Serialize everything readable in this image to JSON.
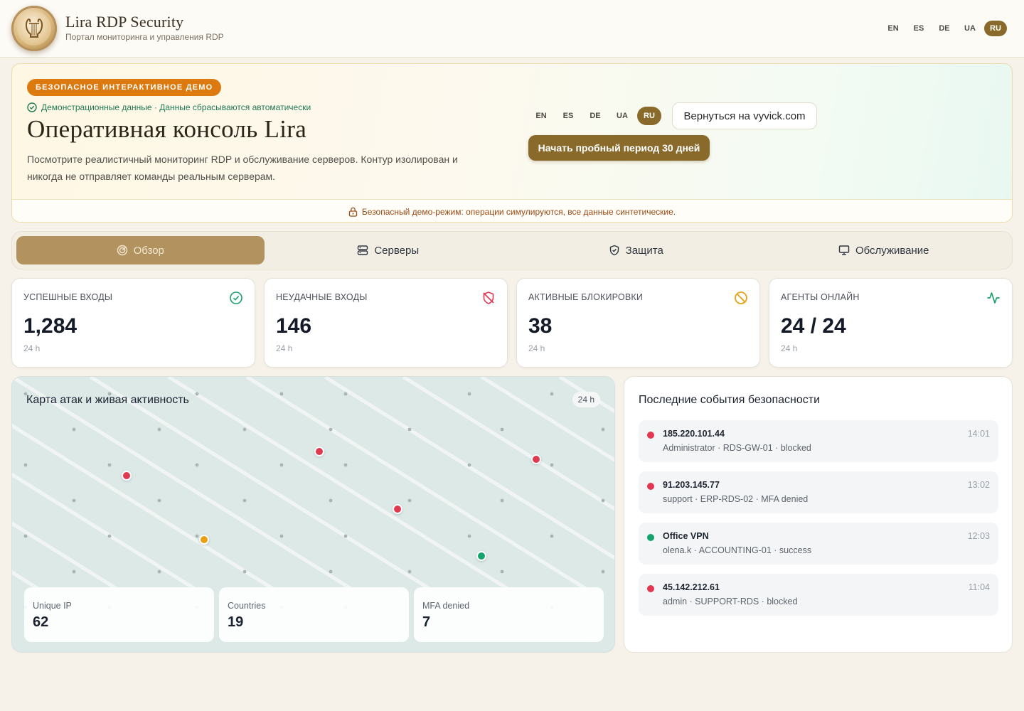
{
  "header": {
    "title": "Lira RDP Security",
    "subtitle": "Портал мониторинга и управления RDP",
    "languages": [
      "EN",
      "ES",
      "DE",
      "UA",
      "RU"
    ],
    "active_language": "RU"
  },
  "hero": {
    "badge": "БЕЗОПАСНОЕ ИНТЕРАКТИВНОЕ ДЕМО",
    "note": "Демонстрационные данные · Данные сбрасываются автоматически",
    "title": "Оперативная консоль Lira",
    "description": "Посмотрите реалистичный мониторинг RDP и обслуживание серверов. Контур изолирован и никогда не отправляет команды реальным серверам.",
    "languages": [
      "EN",
      "ES",
      "DE",
      "UA",
      "RU"
    ],
    "active_language": "RU",
    "back_label": "Вернуться на vyvick.com",
    "trial_label": "Начать пробный период 30 дней",
    "safe_mode_note": "Безопасный демо-режим: операции симулируются, все данные синтетические."
  },
  "tabs": [
    {
      "label": "Обзор",
      "icon": "radar-icon",
      "active": true
    },
    {
      "label": "Серверы",
      "icon": "server-icon",
      "active": false
    },
    {
      "label": "Защита",
      "icon": "shield-icon",
      "active": false
    },
    {
      "label": "Обслуживание",
      "icon": "monitor-icon",
      "active": false
    }
  ],
  "stats": [
    {
      "label": "УСПЕШНЫЕ ВХОДЫ",
      "value": "1,284",
      "period": "24 h",
      "icon": "check-circle-icon",
      "color": "#1aa06a"
    },
    {
      "label": "НЕУДАЧНЫЕ ВХОДЫ",
      "value": "146",
      "period": "24 h",
      "icon": "shield-off-icon",
      "color": "#e0384f"
    },
    {
      "label": "АКТИВНЫЕ БЛОКИРОВКИ",
      "value": "38",
      "period": "24 h",
      "icon": "ban-icon",
      "color": "#e9a012"
    },
    {
      "label": "АГЕНТЫ ОНЛАЙН",
      "value": "24 / 24",
      "period": "24 h",
      "icon": "activity-icon",
      "color": "#1aa06a"
    }
  ],
  "map": {
    "title": "Карта атак и живая активность",
    "period": "24 h",
    "points": [
      {
        "status": "blocked",
        "color": "#e0384f"
      },
      {
        "status": "blocked",
        "color": "#e0384f"
      },
      {
        "status": "blocked",
        "color": "#e0384f"
      },
      {
        "status": "blocked",
        "color": "#e0384f"
      },
      {
        "status": "warning",
        "color": "#e9a012"
      },
      {
        "status": "success",
        "color": "#13a36c"
      }
    ],
    "summary": [
      {
        "label": "Unique IP",
        "value": "62"
      },
      {
        "label": "Countries",
        "value": "19"
      },
      {
        "label": "MFA denied",
        "value": "7"
      }
    ]
  },
  "events": {
    "title": "Последние события безопасности",
    "items": [
      {
        "source": "185.220.101.44",
        "detail": "Administrator · RDS-GW-01 · blocked",
        "time": "14:01",
        "color": "#e0384f"
      },
      {
        "source": "91.203.145.77",
        "detail": "support · ERP-RDS-02 · MFA denied",
        "time": "13:02",
        "color": "#e0384f"
      },
      {
        "source": "Office VPN",
        "detail": "olena.k · ACCOUNTING-01 · success",
        "time": "12:03",
        "color": "#13a36c"
      },
      {
        "source": "45.142.212.61",
        "detail": "admin · SUPPORT-RDS · blocked",
        "time": "11:04",
        "color": "#e0384f"
      }
    ]
  }
}
